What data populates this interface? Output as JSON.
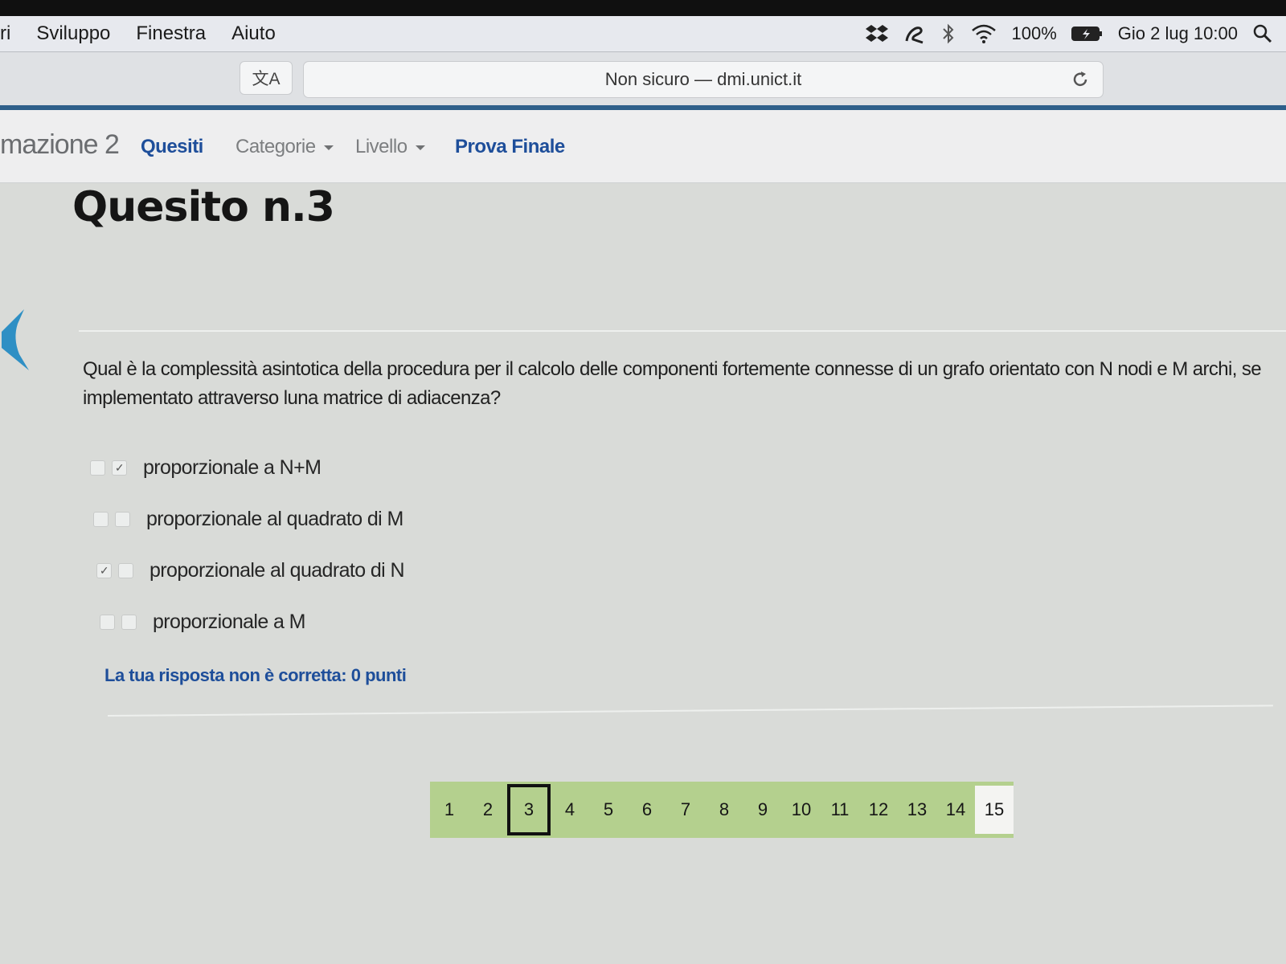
{
  "menubar": {
    "items": [
      "ri",
      "Sviluppo",
      "Finestra",
      "Aiuto"
    ],
    "battery": "100%",
    "datetime": "Gio 2 lug  10:00"
  },
  "toolbar": {
    "translate_label": "文A",
    "address": "Non sicuro — dmi.unict.it"
  },
  "nav": {
    "brand": "mazione 2",
    "links": [
      "Quesiti",
      "Categorie",
      "Livello",
      "Prova Finale"
    ]
  },
  "quiz": {
    "title": "Quesito n.3",
    "question": "Qual è la complessità asintotica della procedura per il calcolo delle componenti fortemente connesse di un grafo orientato con N nodi e M archi, se implementato attraverso luna matrice di adiacenza?",
    "options": [
      {
        "label": "proporzionale a N+M",
        "box1": "",
        "box2": "✓"
      },
      {
        "label": "proporzionale al quadrato di M",
        "box1": "",
        "box2": ""
      },
      {
        "label": "proporzionale al quadrato di N",
        "box1": "✓",
        "box2": ""
      },
      {
        "label": "proporzionale a M",
        "box1": "",
        "box2": ""
      }
    ],
    "feedback": "La tua risposta non è corretta: 0 punti"
  },
  "pagination": {
    "pages": [
      "1",
      "2",
      "3",
      "4",
      "5",
      "6",
      "7",
      "8",
      "9",
      "10",
      "11",
      "12",
      "13",
      "14",
      "15"
    ],
    "current": "3"
  },
  "colors": {
    "accent": "#1e4e9a",
    "page_green": "#b4d08e",
    "url_bar_line": "#2e5f8a"
  }
}
